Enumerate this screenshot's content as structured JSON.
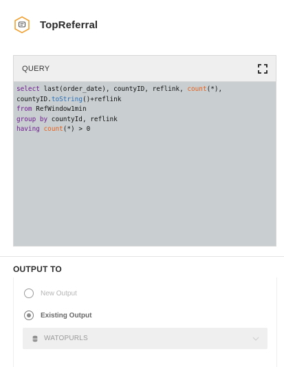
{
  "header": {
    "title": "TopReferral",
    "icon": "hexagon-message-icon",
    "accent_color": "#f0a030"
  },
  "query": {
    "label": "QUERY",
    "expand_icon": "fullscreen-icon",
    "code_lines": [
      "select last(order_date), countyID, reflink, count(*),",
      "countyID.toString()+reflink",
      "from RefWindow1min",
      "group by countyId, reflink",
      "having count(*) > 0"
    ],
    "tokens": {
      "select": "select",
      "last": "last",
      "line1_args": "(order_date), countyID, reflink, ",
      "count": "count",
      "line1_tail": "(*),",
      "line2_head": "countyID.",
      "toString": "toString",
      "line2_tail": "()+reflink",
      "from": "from",
      "from_target": " RefWindow1min",
      "group_by": "group by",
      "group_fields": " countyId, reflink",
      "having": "having",
      "count2": "count",
      "having_tail": "(*) > 0"
    },
    "colors": {
      "keyword": "#6f1a90",
      "function": "#e8601c",
      "method": "#2a6fb8",
      "background": "#c9cfd1"
    }
  },
  "output": {
    "title": "OUTPUT TO",
    "options": [
      {
        "label": "New Output",
        "selected": false
      },
      {
        "label": "Existing Output",
        "selected": true
      }
    ],
    "select": {
      "value": "WATOPURLS",
      "icon": "database-icon",
      "chevron": "chevron-down-icon"
    }
  }
}
